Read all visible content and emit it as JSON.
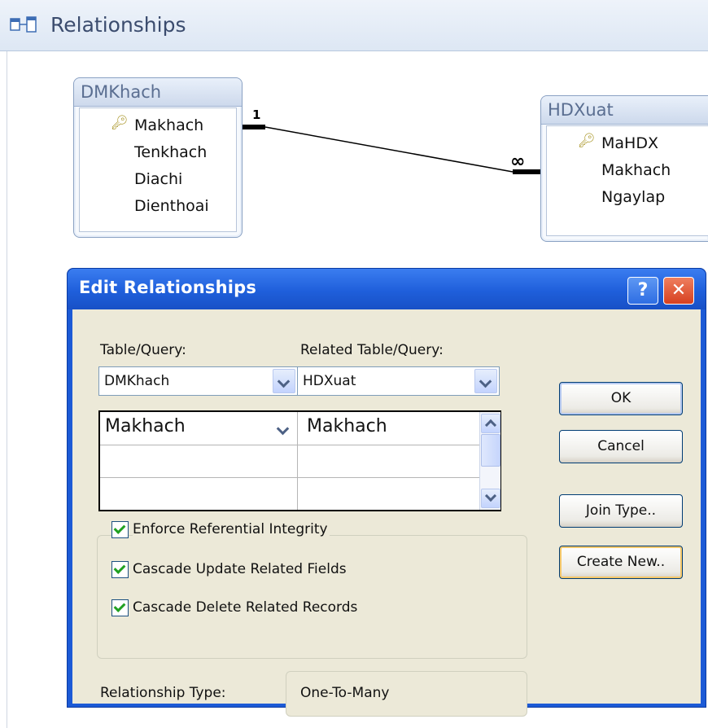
{
  "window": {
    "title": "Relationships"
  },
  "tables": [
    {
      "name": "DMKhach",
      "fields": [
        "Makhach",
        "Tenkhach",
        "Diachi",
        "Dienthoai"
      ],
      "primary_key": "Makhach"
    },
    {
      "name": "HDXuat",
      "fields": [
        "MaHDX",
        "Makhach",
        "Ngaylap"
      ],
      "primary_key": "MaHDX"
    }
  ],
  "relationship_line": {
    "one_label": "1",
    "many_label": "∞"
  },
  "dialog": {
    "title": "Edit Relationships",
    "help_label": "?",
    "close_label": "✕",
    "table_query_label": "Table/Query:",
    "related_table_label": "Related Table/Query:",
    "table_value": "DMKhach",
    "related_value": "HDXuat",
    "field_rows": [
      {
        "left": "Makhach",
        "right": "Makhach"
      },
      {
        "left": "",
        "right": ""
      },
      {
        "left": "",
        "right": ""
      }
    ],
    "checkboxes": [
      {
        "label": "Enforce Referential Integrity",
        "checked": true
      },
      {
        "label": "Cascade Update Related Fields",
        "checked": true
      },
      {
        "label": "Cascade Delete Related Records",
        "checked": true
      }
    ],
    "relationship_type_label": "Relationship Type:",
    "relationship_type_value": "One-To-Many",
    "buttons": {
      "ok": "OK",
      "cancel": "Cancel",
      "join_type": "Join Type..",
      "create_new": "Create New.."
    }
  }
}
